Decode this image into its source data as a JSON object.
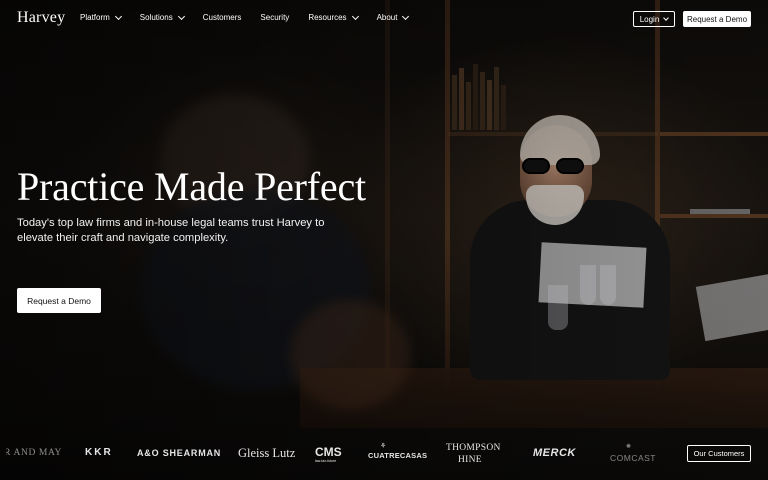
{
  "brand": {
    "name": "Harvey"
  },
  "nav": {
    "items": [
      {
        "label": "Platform",
        "has_dropdown": true
      },
      {
        "label": "Solutions",
        "has_dropdown": true
      },
      {
        "label": "Customers",
        "has_dropdown": false
      },
      {
        "label": "Security",
        "has_dropdown": false
      },
      {
        "label": "Resources",
        "has_dropdown": true
      },
      {
        "label": "About",
        "has_dropdown": true
      }
    ],
    "login_label": "Login",
    "demo_label": "Request a Demo"
  },
  "hero": {
    "title": "Practice Made Perfect",
    "subtitle": "Today's top law firms and in-house legal teams trust Harvey to elevate their craft and navigate complexity.",
    "cta_label": "Request a Demo"
  },
  "clients": {
    "logos": [
      {
        "name": "SLAUGHTER AND MAY"
      },
      {
        "name": "KKR"
      },
      {
        "name": "A&O SHEARMAN"
      },
      {
        "name": "Gleiss Lutz"
      },
      {
        "name": "CMS"
      },
      {
        "name": "CMS tagline",
        "text": "law-tax-future"
      },
      {
        "name": "CUATRECASAS"
      },
      {
        "name": "THOMPSON"
      },
      {
        "name": "HINE"
      },
      {
        "name": "MERCK"
      },
      {
        "name": "COMCAST"
      }
    ],
    "cta_label": "Our Customers"
  },
  "colors": {
    "background": "#0b0a09",
    "text": "#ffffff",
    "button_bg": "#ffffff",
    "button_text": "#111111"
  }
}
